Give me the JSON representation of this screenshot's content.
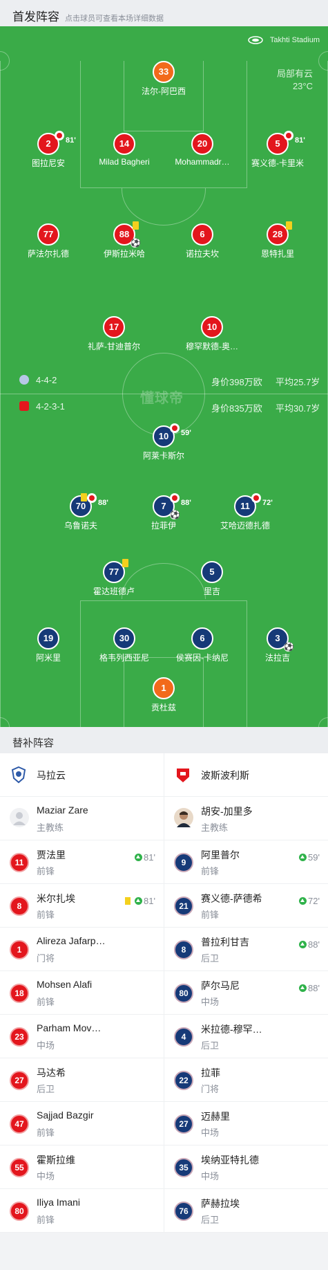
{
  "header": {
    "title": "首发阵容",
    "hint": "点击球员可查看本场详细数据"
  },
  "pitch": {
    "stadium_icon": "stadium-icon",
    "stadium": "Takhti Stadium",
    "weather": "局部有云",
    "temperature": "23°C",
    "watermark": "懂球帝",
    "colors": {
      "pitch": "#3aab48",
      "home": "#e3161d",
      "away": "#163a78",
      "keeper": "#f26a1b"
    }
  },
  "top_team_players": [
    {
      "number": "33",
      "name": "法尔-阿巴西",
      "color": "orange"
    },
    {
      "number": "2",
      "name": "图拉尼安",
      "color": "red",
      "sub_time": "81'"
    },
    {
      "number": "14",
      "name": "Milad Bagheri",
      "color": "red"
    },
    {
      "number": "20",
      "name": "Mohammadr…",
      "color": "red"
    },
    {
      "number": "5",
      "name": "赛义德-卡里米",
      "color": "red",
      "sub_time": "81'"
    },
    {
      "number": "77",
      "name": "萨法尔扎德",
      "color": "red"
    },
    {
      "number": "88",
      "name": "伊斯拉米哈",
      "color": "red",
      "yellow_card": true,
      "goal": true
    },
    {
      "number": "6",
      "name": "诺拉夫坎",
      "color": "red"
    },
    {
      "number": "28",
      "name": "恩特扎里",
      "color": "red",
      "yellow_card": true
    },
    {
      "number": "17",
      "name": "礼萨-甘迪普尔",
      "color": "red"
    },
    {
      "number": "10",
      "name": "穆罕默德-奥…",
      "color": "red"
    }
  ],
  "formations": {
    "top": {
      "formation": "4-4-2",
      "value": "身价398万欧",
      "age": "平均25.7岁"
    },
    "bottom": {
      "formation": "4-2-3-1",
      "value": "身价835万欧",
      "age": "平均30.7岁"
    }
  },
  "bottom_team_players": [
    {
      "number": "10",
      "name": "阿莱卡斯尔",
      "color": "navy",
      "sub_time": "59'"
    },
    {
      "number": "70",
      "name": "乌鲁诺夫",
      "color": "navy",
      "sub_time": "88'",
      "yellow_card": true
    },
    {
      "number": "7",
      "name": "拉菲伊",
      "color": "navy",
      "sub_time": "88'",
      "goal": true
    },
    {
      "number": "11",
      "name": "艾哈迈德扎德",
      "color": "navy",
      "sub_time": "72'"
    },
    {
      "number": "77",
      "name": "霍达班德卢",
      "color": "navy",
      "yellow_card": true
    },
    {
      "number": "5",
      "name": "里吉",
      "color": "navy"
    },
    {
      "number": "19",
      "name": "阿米里",
      "color": "navy"
    },
    {
      "number": "30",
      "name": "格韦列西亚尼",
      "color": "navy"
    },
    {
      "number": "6",
      "name": "侯赛因-卡纳尼",
      "color": "navy"
    },
    {
      "number": "3",
      "name": "法拉吉",
      "color": "navy",
      "goal": true
    },
    {
      "number": "1",
      "name": "贡杜兹",
      "color": "orange"
    }
  ],
  "subs": {
    "title": "替补阵容",
    "left_team": {
      "name": "马拉云",
      "logo_icon": "club-crest-icon"
    },
    "right_team": {
      "name": "波斯波利斯",
      "logo_icon": "club-crest-icon"
    },
    "left_coach": {
      "name": "Maziar Zare",
      "role": "主教练"
    },
    "right_coach": {
      "name": "胡安-加里多",
      "role": "主教练"
    },
    "left_players": [
      {
        "number": "11",
        "name": "贾法里",
        "position": "前锋",
        "in_time": "81'"
      },
      {
        "number": "8",
        "name": "米尔扎埃",
        "position": "前锋",
        "in_time": "81'",
        "yellow_card": true
      },
      {
        "number": "1",
        "name": "Alireza Jafarp…",
        "position": "门将"
      },
      {
        "number": "18",
        "name": "Mohsen Alafi",
        "position": "前锋"
      },
      {
        "number": "23",
        "name": "Parham Mov…",
        "position": "中场"
      },
      {
        "number": "27",
        "name": "马达希",
        "position": "后卫"
      },
      {
        "number": "47",
        "name": "Sajjad Bazgir",
        "position": "前锋"
      },
      {
        "number": "55",
        "name": "霍斯拉维",
        "position": "中场"
      },
      {
        "number": "80",
        "name": "Iliya Imani",
        "position": "前锋"
      }
    ],
    "right_players": [
      {
        "number": "9",
        "name": "阿里普尔",
        "position": "前锋",
        "in_time": "59'"
      },
      {
        "number": "21",
        "name": "赛义德-萨德希",
        "position": "前锋",
        "in_time": "72'"
      },
      {
        "number": "8",
        "name": "普拉利甘吉",
        "position": "后卫",
        "in_time": "88'"
      },
      {
        "number": "80",
        "name": "萨尔马尼",
        "position": "中场",
        "in_time": "88'"
      },
      {
        "number": "4",
        "name": "米拉德-穆罕…",
        "position": "后卫"
      },
      {
        "number": "22",
        "name": "拉菲",
        "position": "门将"
      },
      {
        "number": "27",
        "name": "迈赫里",
        "position": "中场"
      },
      {
        "number": "35",
        "name": "埃纳亚特扎德",
        "position": "中场"
      },
      {
        "number": "76",
        "name": "萨赫拉埃",
        "position": "后卫"
      }
    ]
  }
}
